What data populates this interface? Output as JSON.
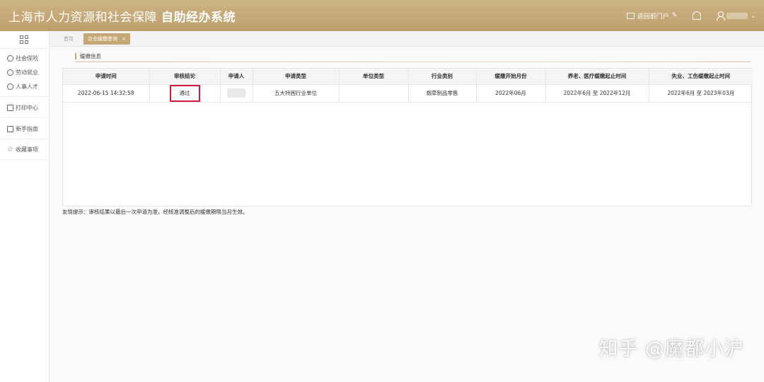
{
  "header": {
    "title_regular": "上海市人力资源和社会保障",
    "title_bold": "自助经办系统",
    "portal_label": "返回前门户",
    "portal_edit_glyph": "✎"
  },
  "sidebar": {
    "items": [
      {
        "label": "社会保险",
        "icon": "settings-icon"
      },
      {
        "label": "劳动就业",
        "icon": "person-icon"
      },
      {
        "label": "人事人才",
        "icon": "person-icon"
      },
      {
        "label": "打印中心",
        "icon": "printer-icon"
      },
      {
        "label": "新手指南",
        "icon": "guide-icon"
      },
      {
        "label": "收藏事项",
        "icon": "star-icon"
      }
    ]
  },
  "tabs": {
    "home": "首页",
    "active": "企业缓缴查询",
    "close_glyph": "×"
  },
  "section": {
    "title": "缓缴信息"
  },
  "table": {
    "headers": [
      "申请时间",
      "审核结论",
      "申请人",
      "申请类型",
      "单位类型",
      "行业类别",
      "缓缴开始月份",
      "养老、医疗缓缴起止时间",
      "失业、工伤缓缴起止时间"
    ],
    "row": {
      "apply_time": "2022-06-15 14:32:58",
      "result": "通过",
      "applicant": "",
      "apply_type": "五大特困行业单位",
      "unit_type": "",
      "industry": "烟草制品零售",
      "start_month": "2022年06月",
      "pension_period": "2022年6月 至 2022年12月",
      "unemployment_period": "2022年6月 至 2023年03月"
    }
  },
  "tip": "友情提示：审核结果以最后一次申请为准，经核准调整后的缓缴期限当月生效。",
  "watermark": "知乎 @魔都小沪",
  "colors": {
    "header": "#c6a877",
    "highlight_border": "#d9163f"
  }
}
